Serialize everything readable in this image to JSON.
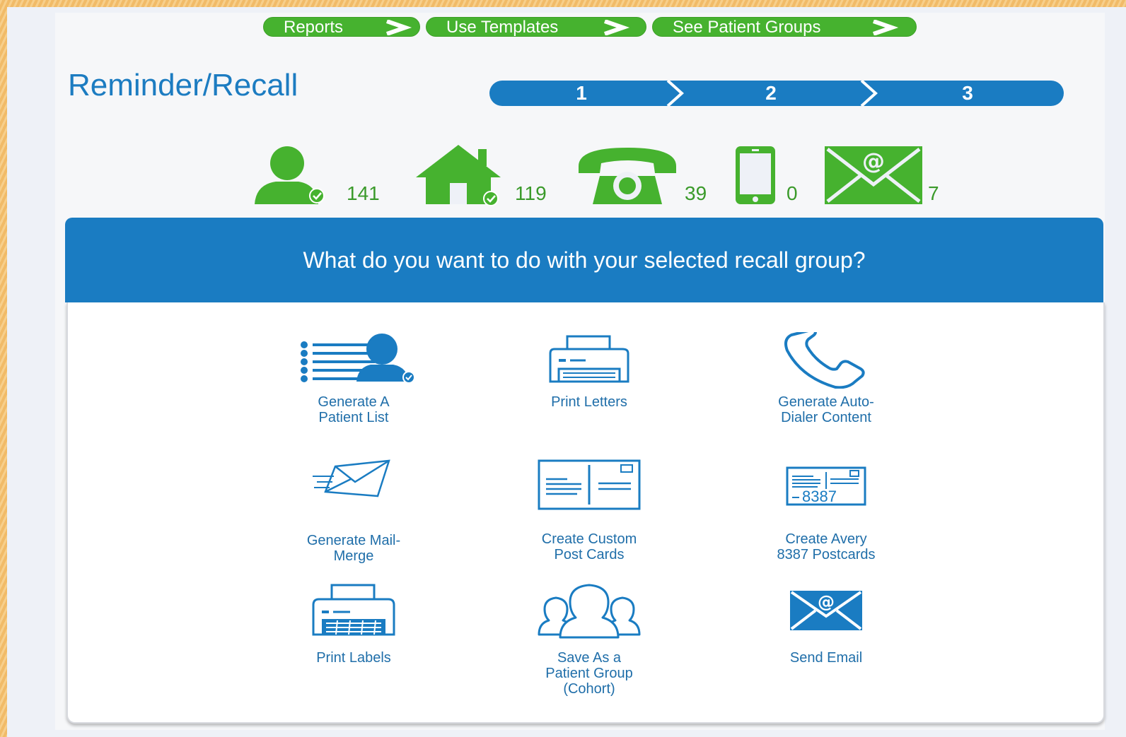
{
  "nav": {
    "reports": "Reports",
    "use_templates": "Use Templates",
    "see_patient_groups": "See Patient Groups"
  },
  "title": "Reminder/Recall",
  "steps": [
    "1",
    "2",
    "3"
  ],
  "stats": {
    "patients": "141",
    "addresses": "119",
    "phones": "39",
    "mobiles": "0",
    "emails": "7"
  },
  "question": "What do you want to do with your selected recall group?",
  "actions": {
    "patient_list": "Generate A\nPatient List",
    "print_letters": "Print Letters",
    "auto_dialer": "Generate Auto-\nDialer Content",
    "mail_merge": "Generate Mail-\nMerge",
    "custom_post_cards": "Create Custom\nPost Cards",
    "avery_postcards": "Create Avery\n8387 Postcards",
    "avery_number": "8387",
    "print_labels": "Print Labels",
    "patient_group": "Save As a\nPatient Group\n(Cohort)",
    "send_email": "Send Email"
  },
  "colors": {
    "green": "#46b22f",
    "blue": "#1a7cc2",
    "title_blue": "#1c7cc1",
    "label_blue": "#1f6ea9",
    "stat_green": "#3a9a2a"
  }
}
